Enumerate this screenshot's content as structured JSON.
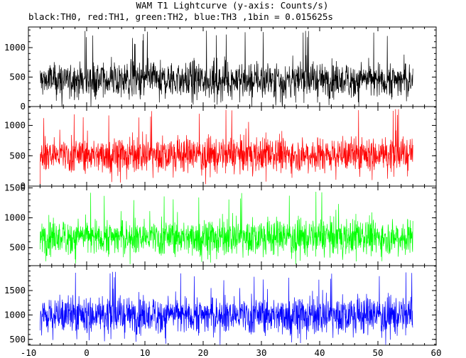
{
  "chart_data": {
    "type": "line",
    "title": "WAM T1 Lightcurve (y-axis: Counts/s)",
    "subtitle": "black:TH0, red:TH1, green:TH2, blue:TH3 ,1bin = 0.015625s",
    "xlim": [
      -10,
      60
    ],
    "x_ticks": [
      -10,
      0,
      10,
      20,
      30,
      40,
      50,
      60
    ],
    "x_range_of_data": [
      -8,
      56
    ],
    "grid": false,
    "panels": [
      {
        "series_label": "TH0",
        "color": "#000000",
        "ylim": [
          0,
          1350
        ],
        "y_ticks": [
          0,
          500,
          1000
        ],
        "baseline": 450,
        "low_envelope": 100,
        "high_envelope": 1000,
        "max_spike": 1300
      },
      {
        "series_label": "TH1",
        "color": "#ff0000",
        "ylim": [
          0,
          1310
        ],
        "y_ticks": [
          0,
          500,
          1000
        ],
        "baseline": 520,
        "low_envelope": 150,
        "high_envelope": 1000,
        "max_spike": 1280
      },
      {
        "series_label": "TH2",
        "color": "#00ff00",
        "ylim": [
          200,
          1530
        ],
        "y_ticks": [
          500,
          1000,
          1500
        ],
        "baseline": 680,
        "low_envelope": 350,
        "high_envelope": 1250,
        "max_spike": 1460
      },
      {
        "series_label": "TH3",
        "color": "#0000ff",
        "ylim": [
          380,
          2010
        ],
        "y_ticks": [
          500,
          1000,
          1500
        ],
        "baseline": 1000,
        "low_envelope": 550,
        "high_envelope": 1700,
        "max_spike": 1900
      }
    ]
  }
}
